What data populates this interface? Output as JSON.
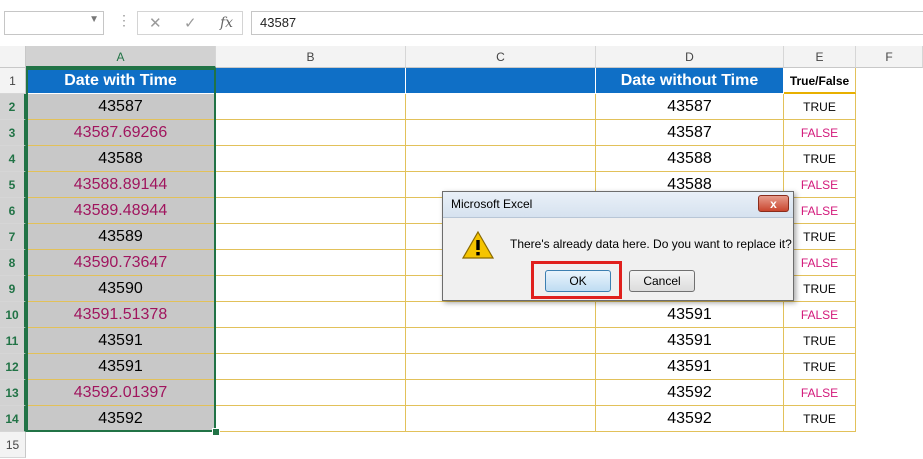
{
  "formula_bar": {
    "name_box": "",
    "cancel_icon": "✕",
    "enter_icon": "✓",
    "fx_label": "fx",
    "content": "43587"
  },
  "columns": [
    "A",
    "B",
    "C",
    "D",
    "E",
    "F"
  ],
  "rows": [
    "1",
    "2",
    "3",
    "4",
    "5",
    "6",
    "7",
    "8",
    "9",
    "10",
    "11",
    "12",
    "13",
    "14",
    "15"
  ],
  "headers": {
    "a": "Date with Time",
    "d": "Date without Time",
    "e": "True/False"
  },
  "col_a": [
    "43587",
    "43587.69266",
    "43588",
    "43588.89144",
    "43589.48944",
    "43589",
    "43590.73647",
    "43590",
    "43591.51378",
    "43591",
    "43591",
    "43592.01397",
    "43592"
  ],
  "col_d": [
    "43587",
    "43587",
    "43588",
    "43588",
    "",
    "",
    "",
    "",
    "43591",
    "43591",
    "43591",
    "43592",
    "43592"
  ],
  "col_e": [
    "TRUE",
    "FALSE",
    "TRUE",
    "FALSE",
    "FALSE",
    "TRUE",
    "FALSE",
    "TRUE",
    "FALSE",
    "TRUE",
    "TRUE",
    "FALSE",
    "TRUE"
  ],
  "dialog": {
    "title": "Microsoft Excel",
    "close": "x",
    "message": "There's already data here. Do you want to replace it?",
    "ok_label": "OK",
    "cancel_label": "Cancel",
    "icon": "warning-icon"
  },
  "colors": {
    "header_blue": "#0f6fc6",
    "false_text": "#d3197b",
    "fractional_text": "#a0155e",
    "selection_green": "#217346",
    "highlight_red": "#e0201d"
  }
}
